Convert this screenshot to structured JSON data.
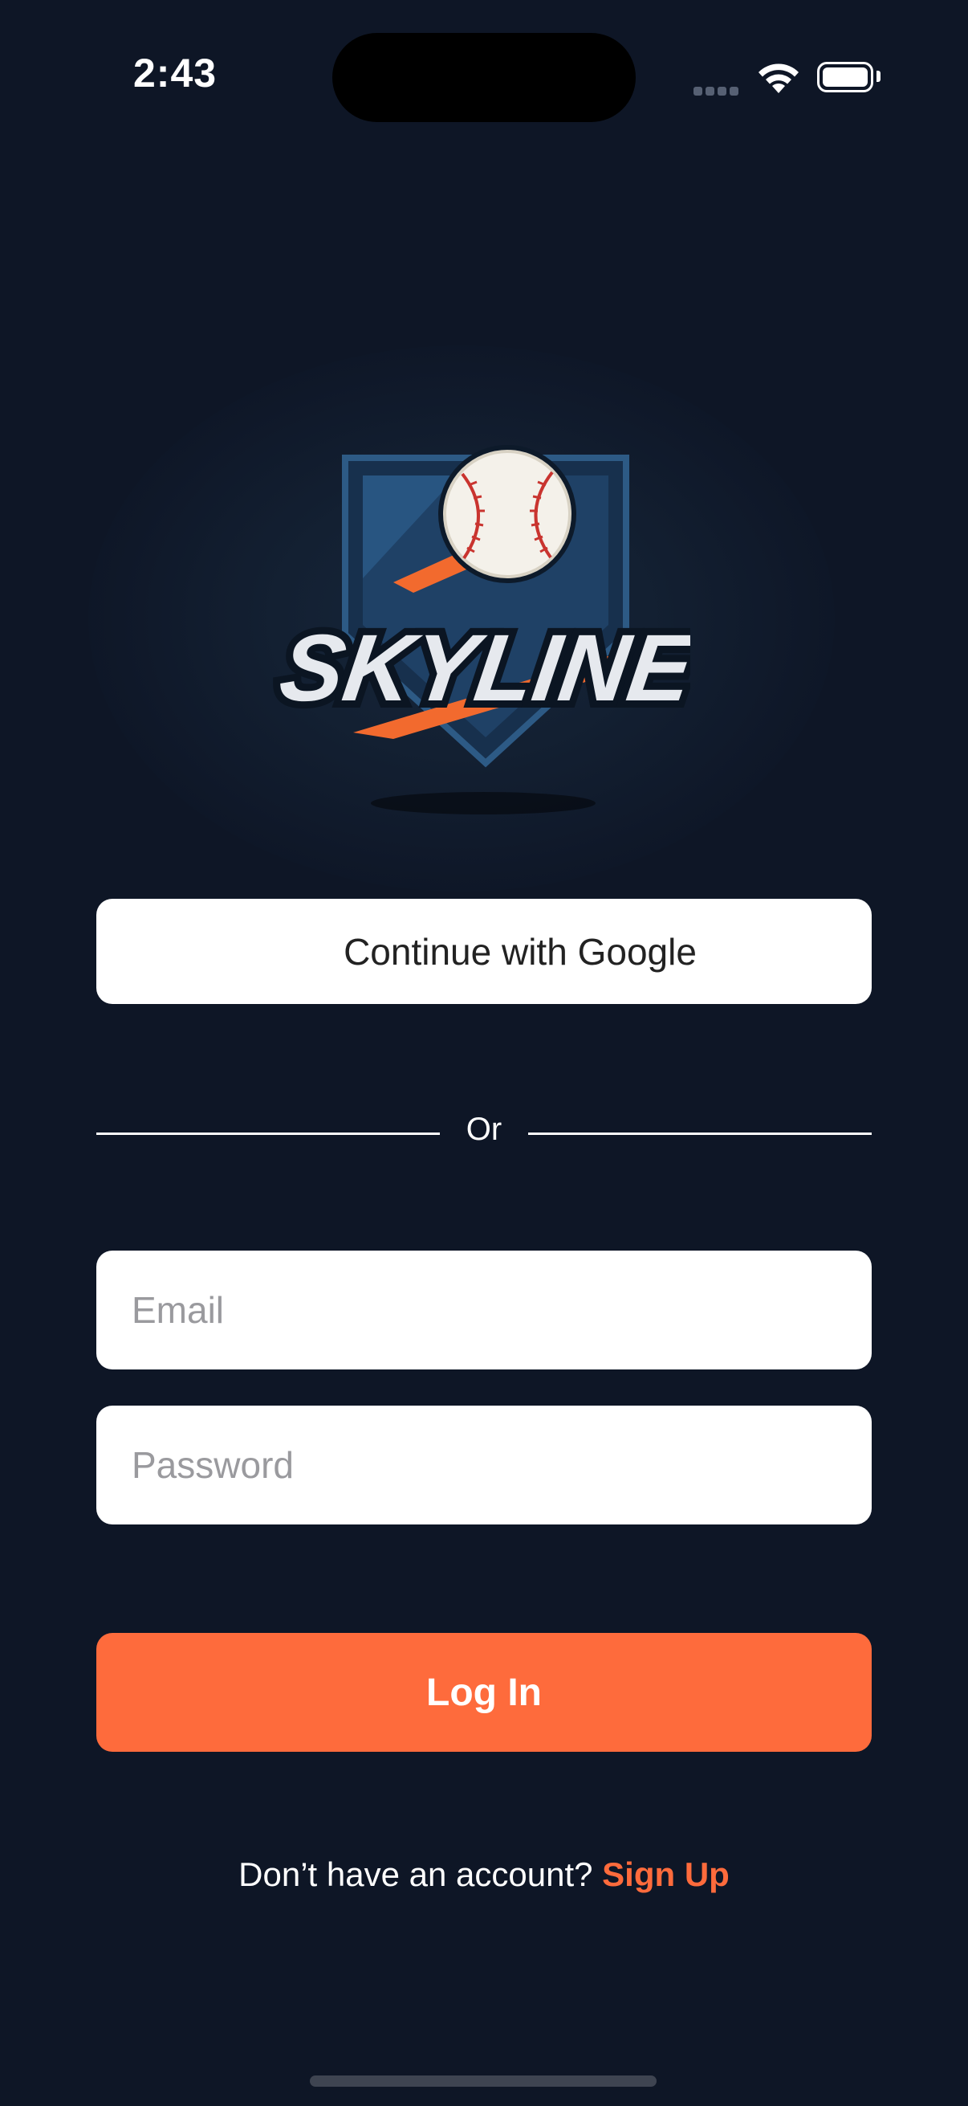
{
  "status_bar": {
    "time": "2:43"
  },
  "logo": {
    "text": "SKYLINE",
    "colors": {
      "shield": "#1d3a5c",
      "accent": "#f26a2e",
      "text": "#e6e9ee"
    }
  },
  "google_button": {
    "label": "Continue with Google"
  },
  "divider": {
    "label": "Or"
  },
  "email_field": {
    "placeholder": "Email",
    "value": ""
  },
  "password_field": {
    "placeholder": "Password",
    "value": ""
  },
  "login_button": {
    "label": "Log In"
  },
  "signup": {
    "prompt": "Don’t have an account?",
    "link_label": "Sign Up"
  },
  "colors": {
    "background": "#0e1626",
    "accent": "#fe6b3c",
    "input_background": "#ffffff",
    "placeholder": "#9a9a9e"
  }
}
